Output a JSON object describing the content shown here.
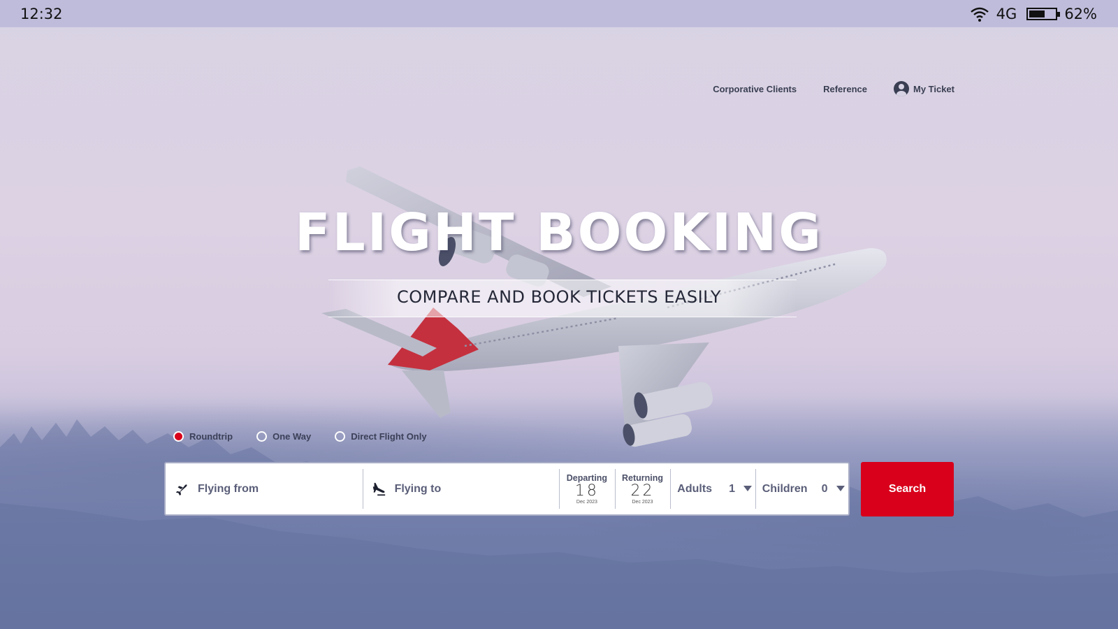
{
  "status_bar": {
    "time": "12:32",
    "network": "4G",
    "battery_percent_label": "62%",
    "battery_level": 0.62,
    "icons": [
      "wifi-icon",
      "battery-icon"
    ]
  },
  "nav": {
    "items": [
      {
        "label": "Corporative Clients"
      },
      {
        "label": "Reference"
      },
      {
        "label": "My Ticket",
        "icon": "user-circle-icon"
      }
    ]
  },
  "hero": {
    "title": "FLIGHT BOOKING",
    "subtitle": "COMPARE AND BOOK TICKETS EASILY"
  },
  "trip_options": [
    {
      "label": "Roundtrip",
      "checked": true
    },
    {
      "label": "One Way",
      "checked": false
    },
    {
      "label": "Direct Flight Only",
      "checked": false
    }
  ],
  "search": {
    "from_placeholder": "Flying from",
    "to_placeholder": "Flying to",
    "departing": {
      "label": "Departing",
      "day": "18",
      "month": "Dec 2023"
    },
    "returning": {
      "label": "Returning",
      "day": "22",
      "month": "Dec 2023"
    },
    "adults": {
      "label": "Adults",
      "value": "1"
    },
    "children": {
      "label": "Children",
      "value": "0"
    },
    "button_label": "Search"
  },
  "colors": {
    "accent": "#d8001b",
    "text_dark": "#3a3e52"
  }
}
